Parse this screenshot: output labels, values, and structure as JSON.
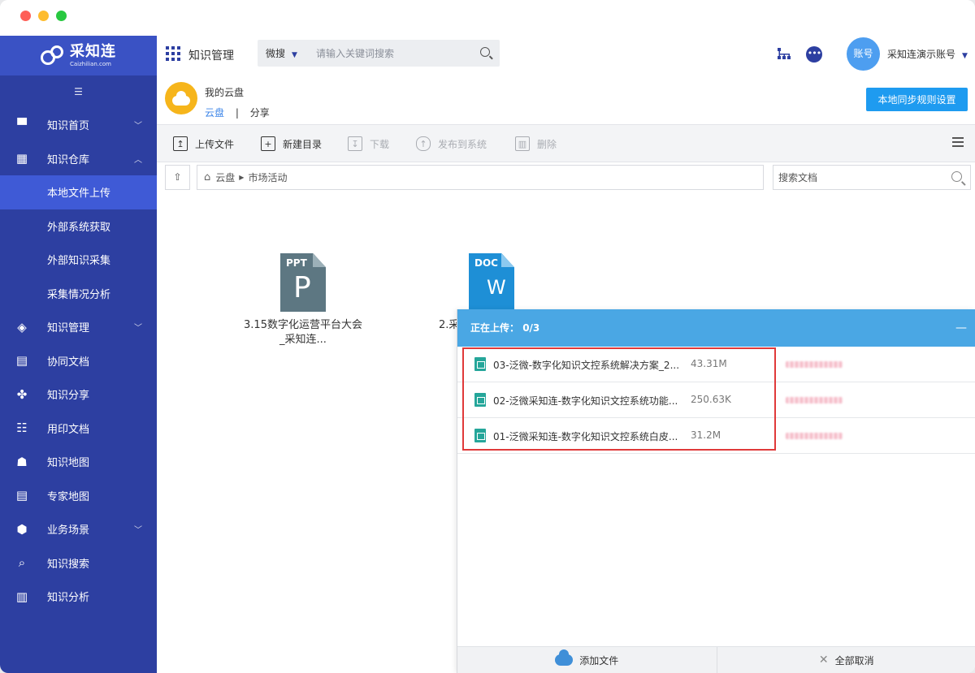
{
  "sidebar": {
    "logo_text": "采知连",
    "logo_sub": "Caizhilian.com",
    "items": [
      {
        "label": "知识首页"
      },
      {
        "label": "知识仓库"
      },
      {
        "label": "本地文件上传"
      },
      {
        "label": "外部系统获取"
      },
      {
        "label": "外部知识采集"
      },
      {
        "label": "采集情况分析"
      },
      {
        "label": "知识管理"
      },
      {
        "label": "协同文档"
      },
      {
        "label": "知识分享"
      },
      {
        "label": "用印文档"
      },
      {
        "label": "知识地图"
      },
      {
        "label": "专家地图"
      },
      {
        "label": "业务场景"
      },
      {
        "label": "知识搜索"
      },
      {
        "label": "知识分析"
      }
    ]
  },
  "header": {
    "title": "知识管理",
    "search_scope": "微搜",
    "search_placeholder": "请输入关键词搜索",
    "avatar_text": "账号",
    "account_name": "采知连演示账号"
  },
  "cloud": {
    "title": "我的云盘",
    "tab_cloud": "云盘",
    "tab_sep": "|",
    "tab_share": "分享",
    "sync_button": "本地同步规则设置"
  },
  "toolbar": {
    "upload": "上传文件",
    "new_folder": "新建目录",
    "download": "下载",
    "publish": "发布到系统",
    "delete": "删除"
  },
  "path": {
    "root": "云盘",
    "current": "市场活动",
    "search_placeholder": "搜索文档"
  },
  "files": [
    {
      "type": "PPT",
      "letter": "P",
      "name": "3.15数字化运营平台大会_采知连..."
    },
    {
      "type": "DOC",
      "letter": "W",
      "name": "2.采"
    }
  ],
  "upload_panel": {
    "title": "正在上传：",
    "progress": "0/3",
    "minimize": "—",
    "items": [
      {
        "name": "03-泛微-数字化知识文控系统解决方案_2...",
        "size": "43.31M"
      },
      {
        "name": "02-泛微采知连-数字化知识文控系统功能...",
        "size": "250.63K"
      },
      {
        "name": "01-泛微采知连-数字化知识文控系统白皮...",
        "size": "31.2M"
      }
    ],
    "add_files": "添加文件",
    "cancel_all": "全部取消"
  },
  "colors": {
    "sidebar_bg": "#2d3fa1",
    "sidebar_active": "#3f5ad6",
    "accent": "#1e9bf0",
    "upload_header": "#4aa7e4",
    "highlight_border": "#e03a3a"
  }
}
